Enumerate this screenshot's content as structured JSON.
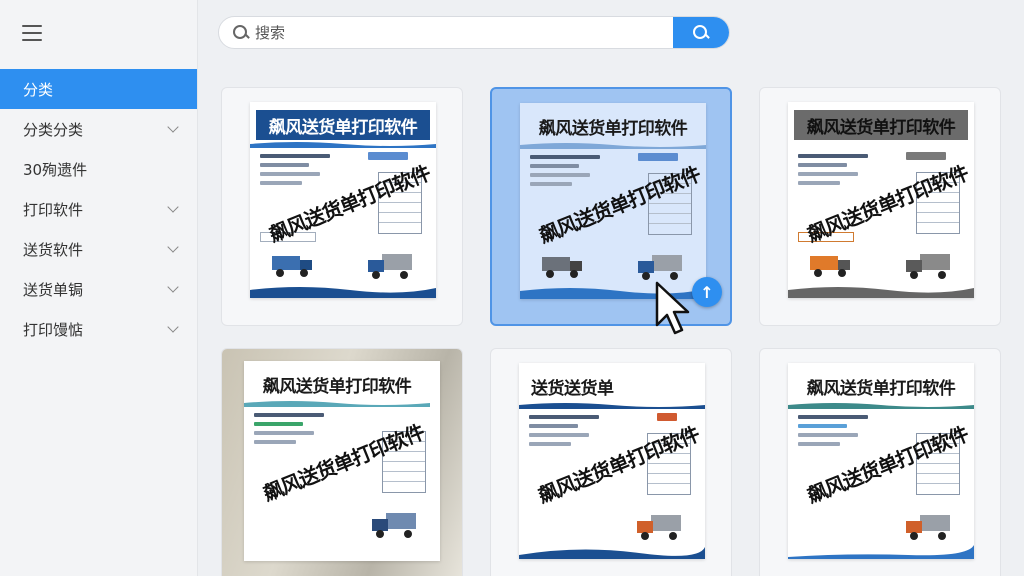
{
  "sidebar": {
    "items": [
      {
        "label": "分类",
        "active": true,
        "has_chevron": false
      },
      {
        "label": "分类分类",
        "active": false,
        "has_chevron": true
      },
      {
        "label": "30殉遗件",
        "active": false,
        "has_chevron": false
      },
      {
        "label": "打印软件",
        "active": false,
        "has_chevron": true
      },
      {
        "label": "送货软件",
        "active": false,
        "has_chevron": true
      },
      {
        "label": "送货单锔",
        "active": false,
        "has_chevron": true
      },
      {
        "label": "打印馒惦",
        "active": false,
        "has_chevron": true
      }
    ]
  },
  "search": {
    "placeholder": "搜索"
  },
  "colors": {
    "accent": "#2e8ff0",
    "doc_header_blue": "#1b4f91",
    "selected_card": "#9fc4f2"
  },
  "cards": [
    {
      "title": "飙风送货单打印软件",
      "watermark": "飙风送货单打印软件",
      "style": "blue",
      "selected": false
    },
    {
      "title": "飙风送货单打印软件",
      "watermark": "飙风送货单打印软件",
      "style": "light",
      "selected": true
    },
    {
      "title": "飙风送货单打印软件",
      "watermark": "飙风送货单打印软件",
      "style": "gray",
      "selected": false
    },
    {
      "title": "飙风送货单打印软件",
      "watermark": "飙风送货单打印软件",
      "style": "photo",
      "selected": false
    },
    {
      "title": "送货送货单",
      "watermark": "飙风送货单打印软件",
      "style": "light",
      "selected": false
    },
    {
      "title": "飙风送货单打印软件",
      "watermark": "飙风送货单打印软件",
      "style": "light",
      "selected": false
    }
  ],
  "icons": {
    "menu": "hamburger-menu-icon",
    "search": "search-icon",
    "upload": "arrow-up-icon",
    "cursor": "mouse-pointer-icon"
  },
  "upload_symbol": "↑"
}
